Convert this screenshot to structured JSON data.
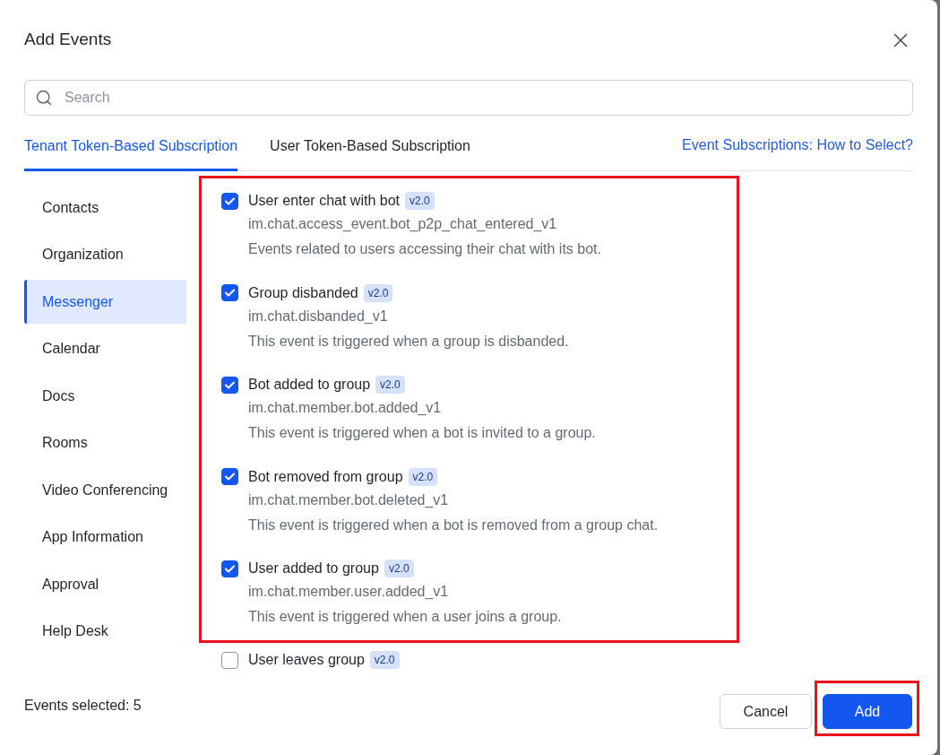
{
  "dialog": {
    "title": "Add Events"
  },
  "search": {
    "placeholder": "Search"
  },
  "tabs": [
    {
      "label": "Tenant Token-Based Subscription",
      "selected": true
    },
    {
      "label": "User Token-Based Subscription",
      "selected": false
    }
  ],
  "help_link": "Event Subscriptions: How to Select?",
  "sidebar": {
    "items": [
      {
        "label": "Contacts",
        "selected": false
      },
      {
        "label": "Organization",
        "selected": false
      },
      {
        "label": "Messenger",
        "selected": true
      },
      {
        "label": "Calendar",
        "selected": false
      },
      {
        "label": "Docs",
        "selected": false
      },
      {
        "label": "Rooms",
        "selected": false
      },
      {
        "label": "Video Conferencing",
        "selected": false
      },
      {
        "label": "App Information",
        "selected": false
      },
      {
        "label": "Approval",
        "selected": false
      },
      {
        "label": "Help Desk",
        "selected": false
      }
    ]
  },
  "events": {
    "items": [
      {
        "name": "User enter chat with bot",
        "version": "v2.0",
        "code": "im.chat.access_event.bot_p2p_chat_entered_v1",
        "description": "Events related to users accessing their chat with its bot.",
        "checked": true,
        "highlighted": true
      },
      {
        "name": "Group disbanded",
        "version": "v2.0",
        "code": "im.chat.disbanded_v1",
        "description": "This event is triggered when a group is disbanded.",
        "checked": true,
        "highlighted": true
      },
      {
        "name": "Bot added to group",
        "version": "v2.0",
        "code": "im.chat.member.bot.added_v1",
        "description": "This event is triggered when a bot is invited to a group.",
        "checked": true,
        "highlighted": true
      },
      {
        "name": "Bot removed from group",
        "version": "v2.0",
        "code": "im.chat.member.bot.deleted_v1",
        "description": "This event is triggered when a bot is removed from a group chat.",
        "checked": true,
        "highlighted": true
      },
      {
        "name": "User added to group",
        "version": "v2.0",
        "code": "im.chat.member.user.added_v1",
        "description": "This event is triggered when a user joins a group.",
        "checked": true,
        "highlighted": true
      },
      {
        "name": "User leaves group",
        "version": "v2.0",
        "checked": false,
        "highlighted": false
      }
    ]
  },
  "footer": {
    "selected_count": "Events selected: 5",
    "buttons": [
      {
        "label": "Cancel",
        "kind": "secondary",
        "highlighted": false
      },
      {
        "label": "Add",
        "kind": "primary",
        "highlighted": true
      }
    ]
  }
}
